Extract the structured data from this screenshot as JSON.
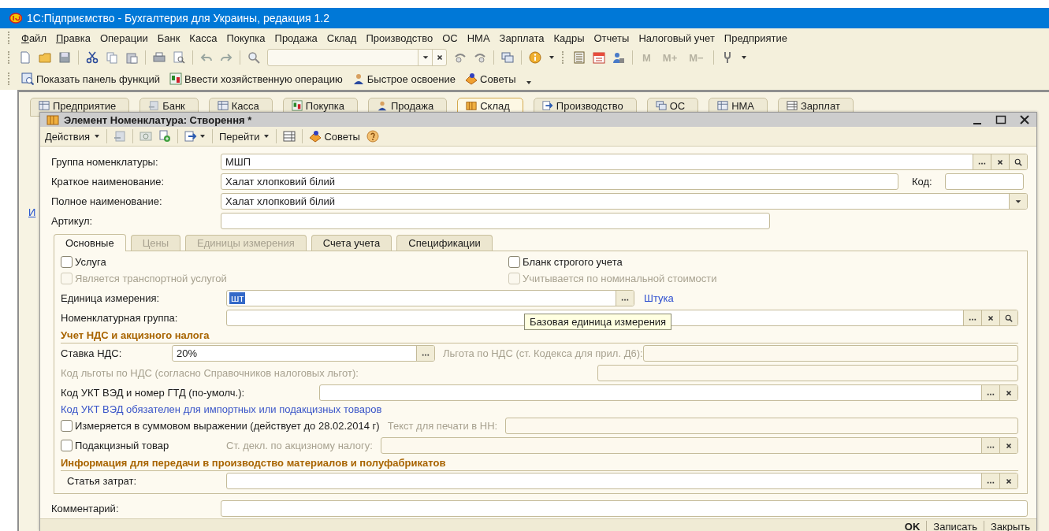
{
  "app_window": {
    "title": "1С:Підприємство - Бухгалтерия для Украины, редакция 1.2"
  },
  "menu": [
    "Файл",
    "Правка",
    "Операции",
    "Банк",
    "Касса",
    "Покупка",
    "Продажа",
    "Склад",
    "Производство",
    "ОС",
    "НМА",
    "Зарплата",
    "Кадры",
    "Отчеты",
    "Налоговый учет",
    "Предприятие"
  ],
  "memory_buttons": [
    {
      "label": "M",
      "disabled": true
    },
    {
      "label": "M+",
      "disabled": true
    },
    {
      "label": "M−",
      "disabled": true
    }
  ],
  "panel_toolbar": [
    "Показать панель функций",
    "Ввести хозяйственную операцию",
    "Быстрое освоение",
    "Советы"
  ],
  "section_tabs": [
    {
      "label": "Предприятие",
      "selected": false
    },
    {
      "label": "Банк",
      "selected": false
    },
    {
      "label": "Касса",
      "selected": false
    },
    {
      "label": "Покупка",
      "selected": false
    },
    {
      "label": "Продажа",
      "selected": false
    },
    {
      "label": "Склад",
      "selected": true
    },
    {
      "label": "Производство",
      "selected": false
    },
    {
      "label": "ОС",
      "selected": false
    },
    {
      "label": "НМА",
      "selected": false
    },
    {
      "label": "Зарплат",
      "selected": false
    }
  ],
  "side_link": "И",
  "dialog": {
    "title": "Элемент Номенклатура: Створення *",
    "toolbar": [
      "Действия",
      "Перейти",
      "Советы"
    ]
  },
  "group": {
    "label": "Группа номенклатуры:",
    "value": "МШП"
  },
  "short_name": {
    "label": "Краткое наименование:",
    "value": "Халат хлопковий білий"
  },
  "code": {
    "label": "Код:"
  },
  "full_name": {
    "label": "Полное наименование:",
    "value": "Халат хлопковий білий"
  },
  "article": {
    "label": "Артикул:"
  },
  "tabs": [
    {
      "label": "Основные",
      "selected": true,
      "disabled": false
    },
    {
      "label": "Цены",
      "selected": false,
      "disabled": true
    },
    {
      "label": "Единицы измерения",
      "selected": false,
      "disabled": true
    },
    {
      "label": "Счета учета",
      "selected": false,
      "disabled": false
    },
    {
      "label": "Спецификации",
      "selected": false,
      "disabled": false
    }
  ],
  "main_tab": {
    "service": {
      "label": "Услуга",
      "checked": false,
      "disabled": false
    },
    "strict_blank": {
      "label": "Бланк строгого учета",
      "checked": false,
      "disabled": false
    },
    "transport": {
      "label": "Является транспортной услугой",
      "checked": false,
      "disabled": true
    },
    "nominal": {
      "label": "Учитывается по номинальной стоимости",
      "checked": false,
      "disabled": true
    },
    "unit": {
      "label": "Единица измерения:",
      "value": "шт",
      "value_selected": true,
      "link": "Штука"
    },
    "nomenclature_group": {
      "label": "Номенклатурная группа:"
    },
    "tooltip": "Базовая единица измерения",
    "vat_heading": "Учет НДС и акцизного налога",
    "vat_rate": {
      "label": "Ставка НДС:",
      "value": "20%"
    },
    "vat_benefit": {
      "label": "Льгота по НДС (ст. Кодекса для прил. Д6):",
      "disabled": true
    },
    "benefit_code": {
      "label": "Код льготы по НДС (согласно Справочников налоговых льгот):",
      "disabled": true
    },
    "uktzed": {
      "label": "Код УКТ ВЭД и номер ГТД (по-умолч.):"
    },
    "uktzed_note": "Код УКТ ВЭД обязателен для импортных или подакцизных товаров",
    "sum_measure": {
      "label": "Измеряется в суммовом выражении (действует до 28.02.2014 г)",
      "checked": false,
      "disabled": false
    },
    "print_text": {
      "label": "Текст для печати в НН:",
      "disabled": true
    },
    "excise": {
      "label": "Подакцизный товар",
      "checked": false,
      "disabled": false
    },
    "excise_decl": {
      "label": "Ст. декл. по акцизному налогу:",
      "disabled": true
    },
    "production_heading": "Информация для передачи в производство материалов и полуфабрикатов",
    "cost_item": {
      "label": "Статья затрат:"
    }
  },
  "comment": {
    "label": "Комментарий:"
  },
  "buttons": [
    {
      "label": "OK",
      "default": true
    },
    {
      "label": "Записать",
      "default": false
    },
    {
      "label": "Закрыть",
      "default": false
    }
  ]
}
